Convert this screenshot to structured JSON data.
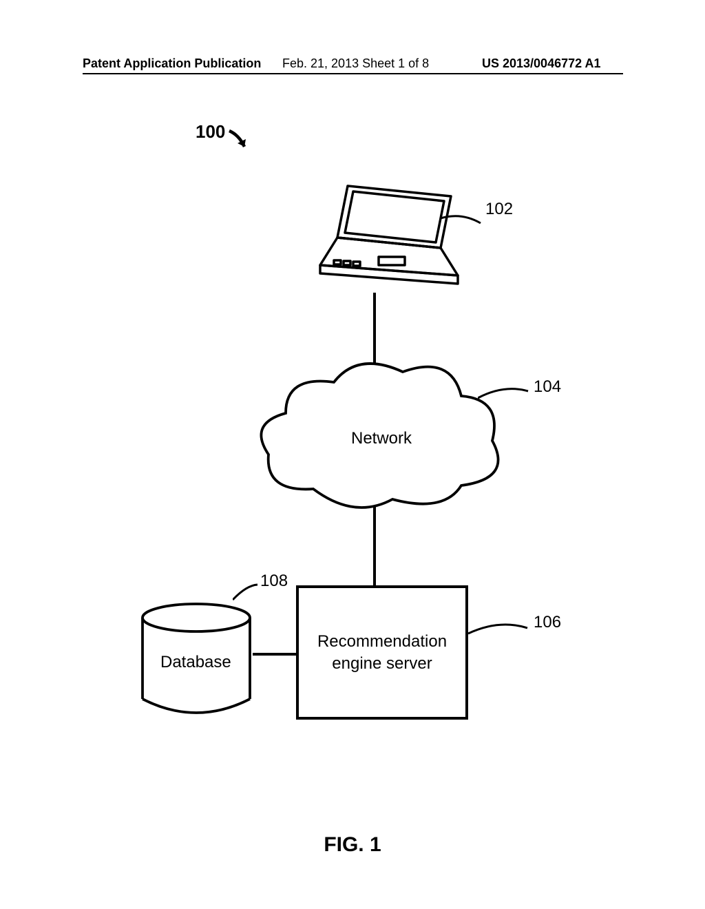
{
  "header": {
    "left": "Patent Application Publication",
    "middle": "Feb. 21, 2013  Sheet 1 of 8",
    "right": "US 2013/0046772 A1"
  },
  "figure": {
    "caption": "FIG. 1",
    "system_ref": "100",
    "elements": {
      "laptop": {
        "ref": "102"
      },
      "network": {
        "label": "Network",
        "ref": "104"
      },
      "server": {
        "label_line1": "Recommendation",
        "label_line2": "engine server",
        "ref": "106"
      },
      "database": {
        "label": "Database",
        "ref": "108"
      }
    }
  },
  "chart_data": {
    "type": "diagram",
    "title": "FIG. 1 — system 100 block diagram",
    "nodes": [
      {
        "id": "102",
        "kind": "client-laptop"
      },
      {
        "id": "104",
        "kind": "network-cloud",
        "label": "Network"
      },
      {
        "id": "106",
        "kind": "server-box",
        "label": "Recommendation engine server"
      },
      {
        "id": "108",
        "kind": "database-cylinder",
        "label": "Database"
      }
    ],
    "edges": [
      {
        "from": "102",
        "to": "104"
      },
      {
        "from": "104",
        "to": "106"
      },
      {
        "from": "108",
        "to": "106"
      }
    ],
    "system_reference": "100"
  }
}
